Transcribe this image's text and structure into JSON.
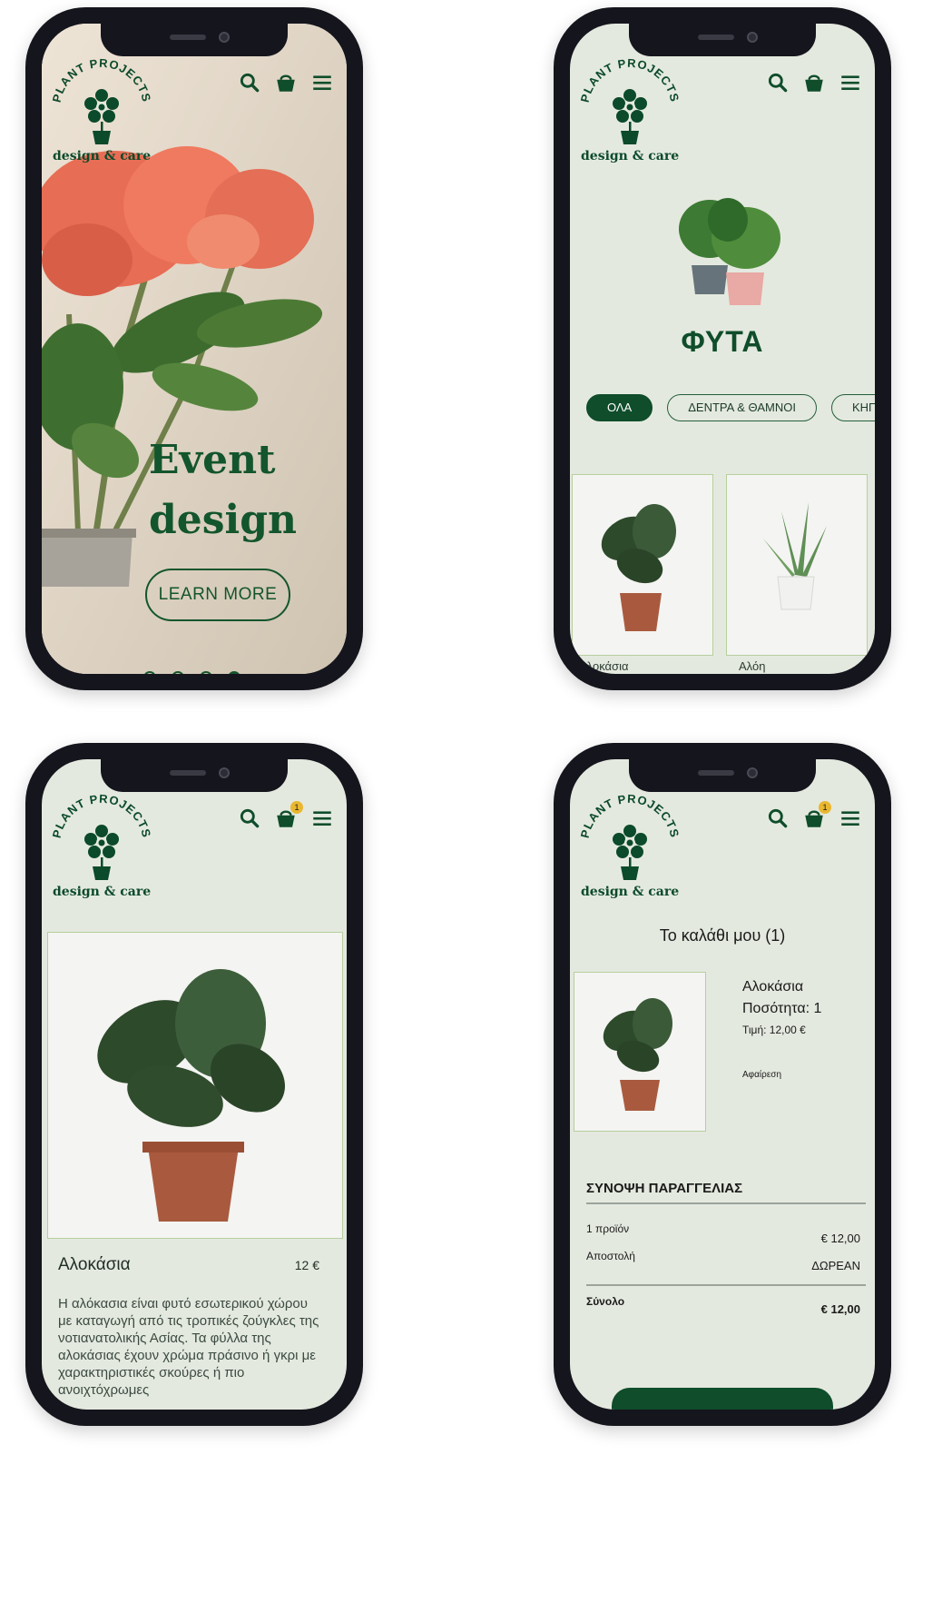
{
  "brand": {
    "name": "PLANT PROJECTS",
    "tagline": "design & care",
    "colors": {
      "primary_green": "#0f4d2b",
      "badge_yellow": "#e9b730",
      "screen_bg": "#e4e9df"
    }
  },
  "header": {
    "icons": [
      "search-icon",
      "basket-icon",
      "menu-icon"
    ],
    "cart_count": "1"
  },
  "home": {
    "hero_title": "Event design",
    "cta_label": "LEARN MORE",
    "carousel": {
      "total": 4,
      "active_index": 4
    }
  },
  "category": {
    "title": "ΦΥΤΑ",
    "filters": [
      {
        "label": "ΟΛΑ",
        "active": true
      },
      {
        "label": "ΔΕΝΤΡΑ & ΘΑΜΝΟΙ",
        "active": false
      },
      {
        "label": "ΚΗΠ",
        "active": false
      }
    ],
    "products": [
      {
        "name": "Αλοκάσια"
      },
      {
        "name": "Αλόη"
      }
    ]
  },
  "product_detail": {
    "name": "Αλοκάσια",
    "price": "12 €",
    "description": "Η αλόκασια είναι φυτό εσωτερικού χώρου με καταγωγή από τις τροπικές ζούγκλες της νοτιανατολικής Ασίας. Τα φύλλα της αλοκάσιας έχουν χρώμα πράσινο ή γκρι με χαρακτηριστικές σκούρες ή πιο ανοιχτόχρωμες"
  },
  "cart": {
    "title": "Το καλάθι μου (1)",
    "item": {
      "name": "Αλοκάσια",
      "quantity": "Ποσότητα: 1",
      "price": "Τιμή: 12,00 €",
      "remove_label": "Αφαίρεση"
    },
    "summary": {
      "title": "ΣΥΝΟΨΗ ΠΑΡΑΓΓΕΛΙΑΣ",
      "rows": [
        {
          "label": "1 προϊόν",
          "value": "€ 12,00"
        },
        {
          "label": "Αποστολή",
          "value": "ΔΩΡΕΑΝ"
        }
      ],
      "total_label": "Σύνολο",
      "total_value": "€ 12,00"
    }
  }
}
